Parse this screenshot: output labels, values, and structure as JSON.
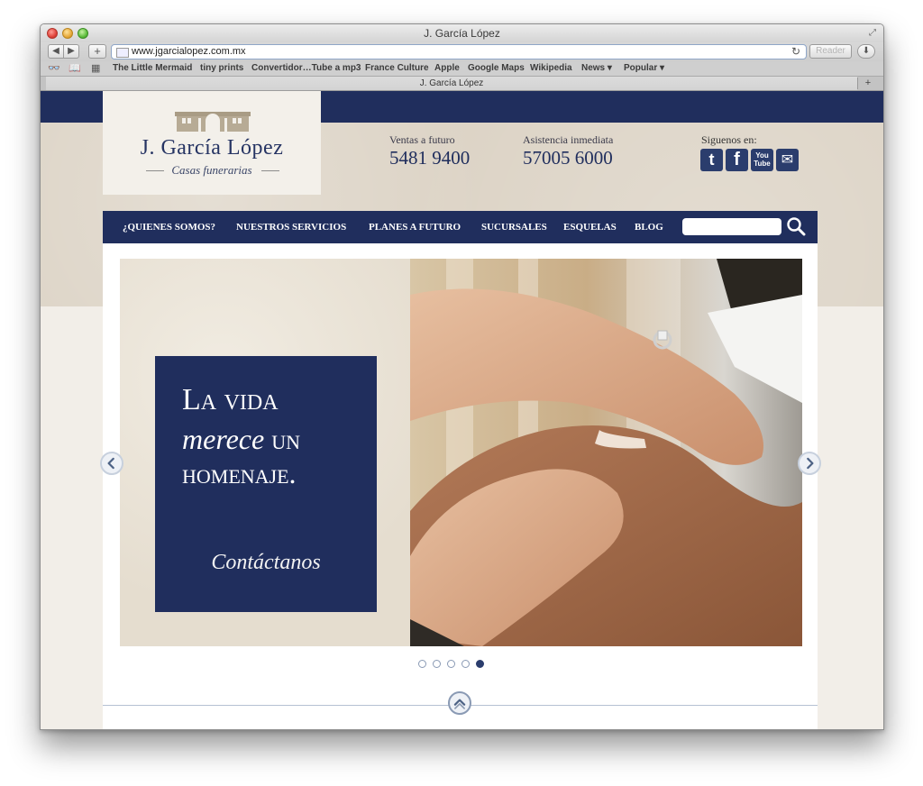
{
  "window": {
    "title": "J. García López"
  },
  "toolbar": {
    "back": "◀",
    "forward": "▶",
    "add": "+",
    "url": "www.jgarcialopez.com.mx",
    "reload": "↻",
    "reader": "Reader"
  },
  "bookmarks": [
    "The Little Mermaid",
    "tiny prints",
    "Convertidor…Tube a mp3",
    "France Culture",
    "Apple",
    "Google Maps",
    "Wikipedia",
    "News ▾",
    "Popular ▾"
  ],
  "tab": {
    "title": "J. García López",
    "add": "+"
  },
  "brand": {
    "name": "J. García López",
    "subtitle": "Casas funerarias"
  },
  "contacts": [
    {
      "label": "Ventas a futuro",
      "number": "5481 9400"
    },
    {
      "label": "Asistencia inmediata",
      "number": "57005 6000"
    }
  ],
  "social": {
    "label": "Siguenos en:",
    "items": [
      {
        "name": "twitter",
        "glyph": "t"
      },
      {
        "name": "facebook",
        "glyph": "f"
      },
      {
        "name": "youtube",
        "glyph": "You\nTube"
      },
      {
        "name": "email",
        "glyph": "✉"
      }
    ]
  },
  "nav": [
    "¿QUIENES SOMOS?",
    "NUESTROS SERVICIOS",
    "PLANES A FUTURO",
    "SUCURSALES",
    "ESQUELAS",
    "BLOG"
  ],
  "search": {
    "placeholder": ""
  },
  "hero": {
    "line1": "La vida",
    "line2a": "merece",
    "line2b": "un",
    "line3": "homenaje.",
    "cta": "Contáctanos"
  },
  "carousel": {
    "total": 5,
    "active": 5
  },
  "colors": {
    "navy": "#202e5d",
    "accent": "#2b3d6d",
    "background": "#dcd3c5"
  }
}
